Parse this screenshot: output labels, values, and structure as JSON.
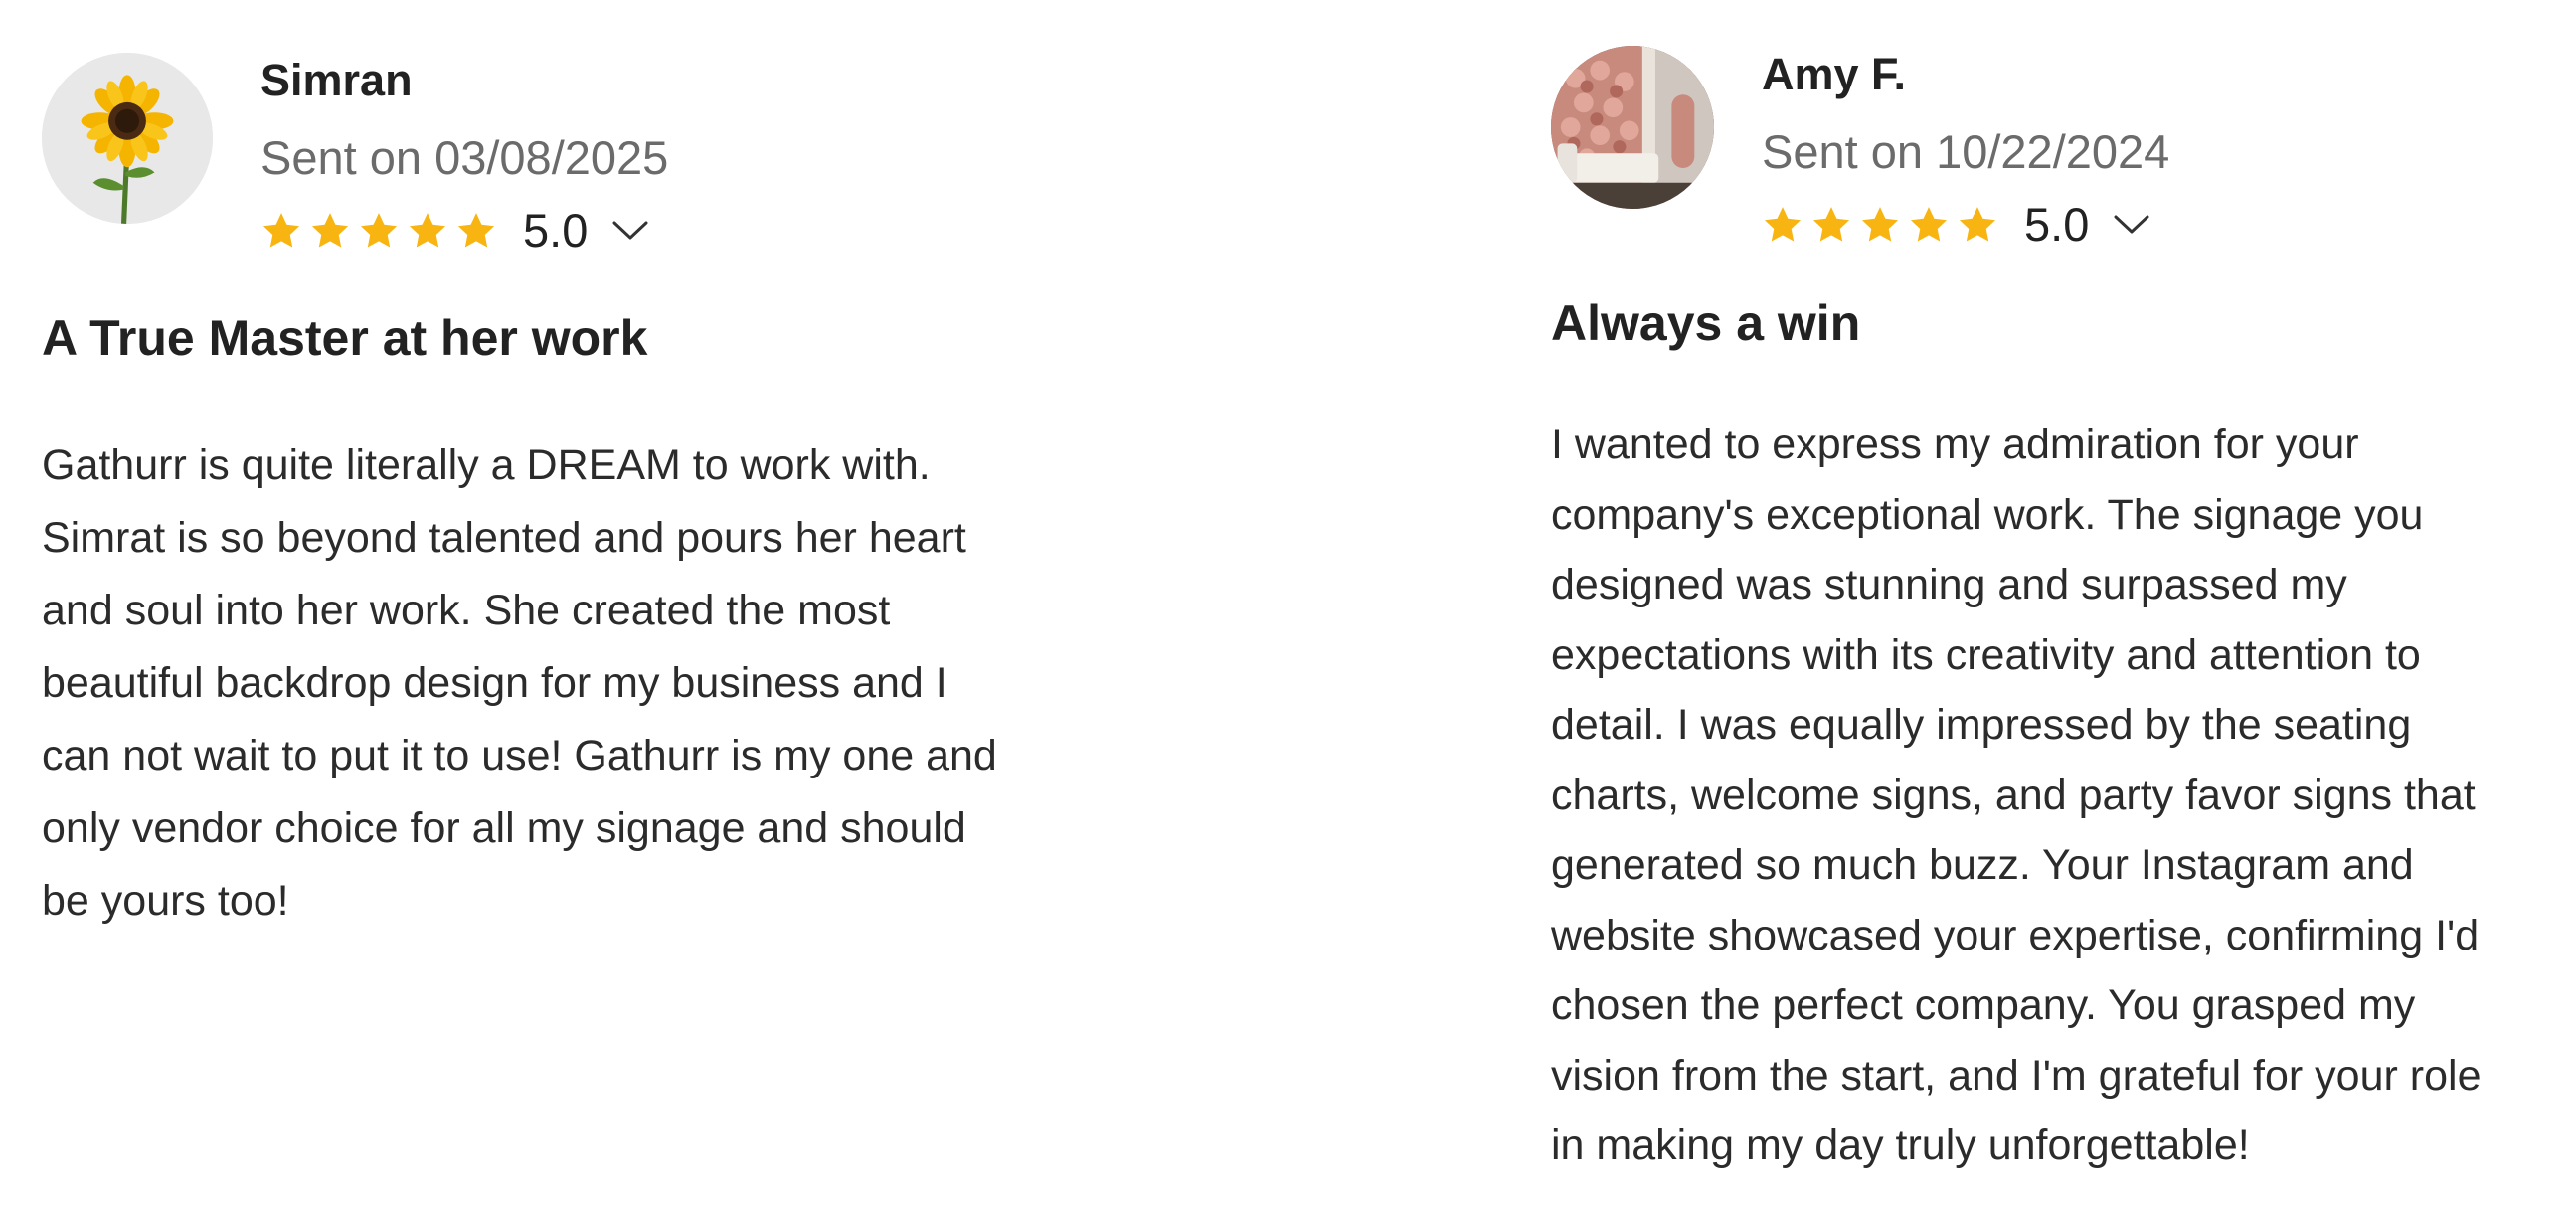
{
  "colors": {
    "star": "#F8B512",
    "name": "#222222",
    "date": "#6B6B6B"
  },
  "reviews": [
    {
      "author": "Simran",
      "avatar_icon": "sunflower-avatar",
      "sent": "Sent on 03/08/2025",
      "rating": 5.0,
      "rating_label": "5.0",
      "stars": 5,
      "title": "A True Master at her work",
      "body": "Gathurr is quite literally a DREAM to work with.\nSimrat is so beyond talented and pours her heart\nand soul into her work. She created the most\nbeautiful backdrop design for my business and I\ncan not wait to put it to use! Gathurr is my one and\nonly vendor choice for all my signage and should\nbe yours too!"
    },
    {
      "author": "Amy F.",
      "avatar_icon": "flower-wall-room-avatar",
      "sent": "Sent on 10/22/2024",
      "rating": 5.0,
      "rating_label": "5.0",
      "stars": 5,
      "title": "Always a win",
      "body": "I wanted to express my admiration for your\ncompany's exceptional work. The signage you\ndesigned was stunning and surpassed my\nexpectations with its creativity and attention to\ndetail. I was equally impressed by the seating\ncharts, welcome signs, and party favor signs that\ngenerated so much buzz. Your Instagram and\nwebsite showcased your expertise, confirming I'd\nchosen the perfect company. You grasped my\nvision from the start, and I'm grateful for your role\nin making my day truly unforgettable!"
    }
  ]
}
